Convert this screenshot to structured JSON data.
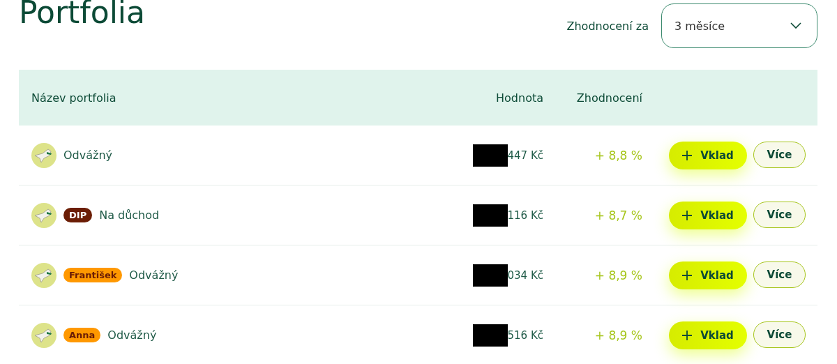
{
  "title": "Portfolia",
  "period": {
    "label": "Zhodnocení za",
    "value": "3 měsíce"
  },
  "table": {
    "columns": [
      "Název portfolia",
      "Hodnota",
      "Zhodnocení"
    ],
    "rows": [
      {
        "name": "Odvážný",
        "value": "447 Kč",
        "return": "+ 8,8 %",
        "deposit": "Vklad",
        "more": "Více"
      },
      {
        "tag": {
          "label": "DIP",
          "kind": "dark",
          "color": "#6b1d05"
        },
        "name": "Na důchod",
        "value": "116 Kč",
        "return": "+ 8,7 %",
        "deposit": "Vklad",
        "more": "Více"
      },
      {
        "tag": {
          "label": "František",
          "kind": "light",
          "color": "#ff9800"
        },
        "name": "Odvážný",
        "value": "034 Kč",
        "return": "+ 8,9 %",
        "deposit": "Vklad",
        "more": "Více"
      },
      {
        "tag": {
          "label": "Anna",
          "kind": "light",
          "color": "#ff9800"
        },
        "name": "Odvážný",
        "value": "516 Kč",
        "return": "+ 8,9 %",
        "deposit": "Vklad",
        "more": "Více"
      }
    ]
  }
}
